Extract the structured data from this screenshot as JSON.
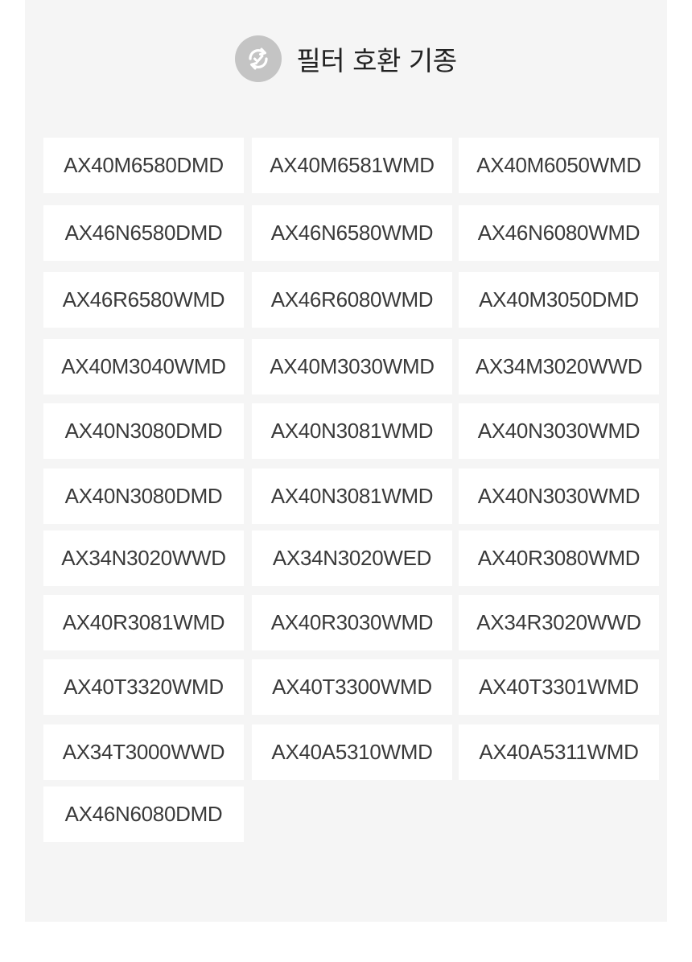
{
  "header": {
    "title": "필터 호환 기종",
    "icon": "refresh-check-icon"
  },
  "models": [
    "AX40M6580DMD",
    "AX40M6581WMD",
    "AX40M6050WMD",
    "AX46N6580DMD",
    "AX46N6580WMD",
    "AX46N6080WMD",
    "AX46R6580WMD",
    "AX46R6080WMD",
    "AX40M3050DMD",
    "AX40M3040WMD",
    "AX40M3030WMD",
    "AX34M3020WWD",
    "AX40N3080DMD",
    "AX40N3081WMD",
    "AX40N3030WMD",
    "AX40N3080DMD",
    "AX40N3081WMD",
    "AX40N3030WMD",
    "AX34N3020WWD",
    "AX34N3020WED",
    "AX40R3080WMD",
    "AX40R3081WMD",
    "AX40R3030WMD",
    "AX34R3020WWD",
    "AX40T3320WMD",
    "AX40T3300WMD",
    "AX40T3301WMD",
    "AX34T3000WWD",
    "AX40A5310WMD",
    "AX40A5311WMD",
    "AX46N6080DMD"
  ]
}
